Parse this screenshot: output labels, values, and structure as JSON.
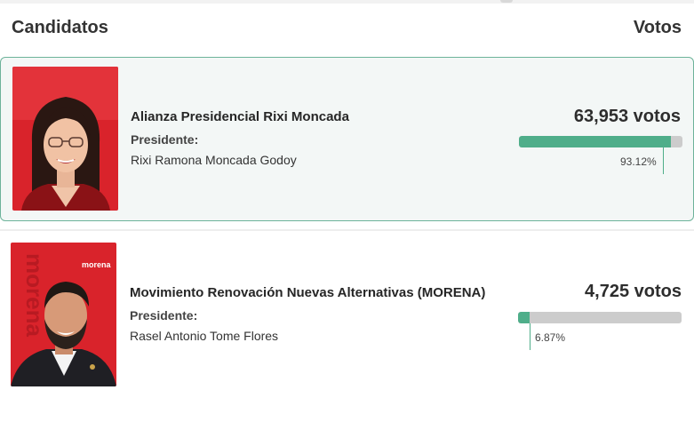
{
  "header": {
    "candidates_label": "Candidatos",
    "votes_label": "Votos"
  },
  "accent_color": "#4fae8a",
  "candidates": [
    {
      "party": "Alianza Presidencial Rixi Moncada",
      "role": "Presidente:",
      "name": "Rixi Ramona Moncada Godoy",
      "votes": "63,953 votos",
      "percent": "93.12%",
      "percent_value": 93.12
    },
    {
      "party": "Movimiento Renovación Nuevas Alternativas (MORENA)",
      "role": "Presidente:",
      "name": "Rasel Antonio Tome Flores",
      "votes": "4,725 votos",
      "percent": "6.87%",
      "percent_value": 6.87,
      "logo_text": "morena",
      "side_text": "morena"
    }
  ]
}
